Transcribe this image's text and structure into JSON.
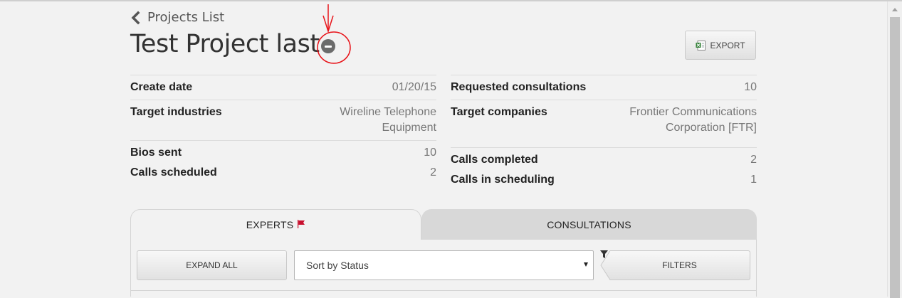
{
  "nav": {
    "back_label": "Projects List"
  },
  "project": {
    "title": "Test Project last"
  },
  "toolbar": {
    "export_label": "EXPORT"
  },
  "info_left": [
    {
      "label": "Create date",
      "value": "01/20/15"
    },
    {
      "label": "Target industries",
      "value": "Wireline Telephone Equipment"
    },
    {
      "label": "Bios sent",
      "value": "10"
    },
    {
      "label": "Calls scheduled",
      "value": "2"
    }
  ],
  "info_right": [
    {
      "label": "Requested consultations",
      "value": "10"
    },
    {
      "label": "Target companies",
      "value": "Frontier Communications Corporation [FTR]"
    },
    {
      "label": "Calls completed",
      "value": "2"
    },
    {
      "label": "Calls in scheduling",
      "value": "1"
    }
  ],
  "tabs": [
    {
      "label": "EXPERTS"
    },
    {
      "label": "CONSULTATIONS"
    }
  ],
  "controls": {
    "expand_label": "EXPAND ALL",
    "sort_selected": "Sort by Status",
    "filters_label": "FILTERS"
  },
  "colors": {
    "annotation": "#e8141a",
    "flag": "#c8102e",
    "background": "#f2f2f2"
  },
  "icons": {
    "back": "chevron-left-icon",
    "remove": "minus-circle-icon",
    "export": "excel-icon",
    "flag": "flag-icon",
    "filter": "funnel-icon",
    "dropdown": "caret-down-icon"
  }
}
